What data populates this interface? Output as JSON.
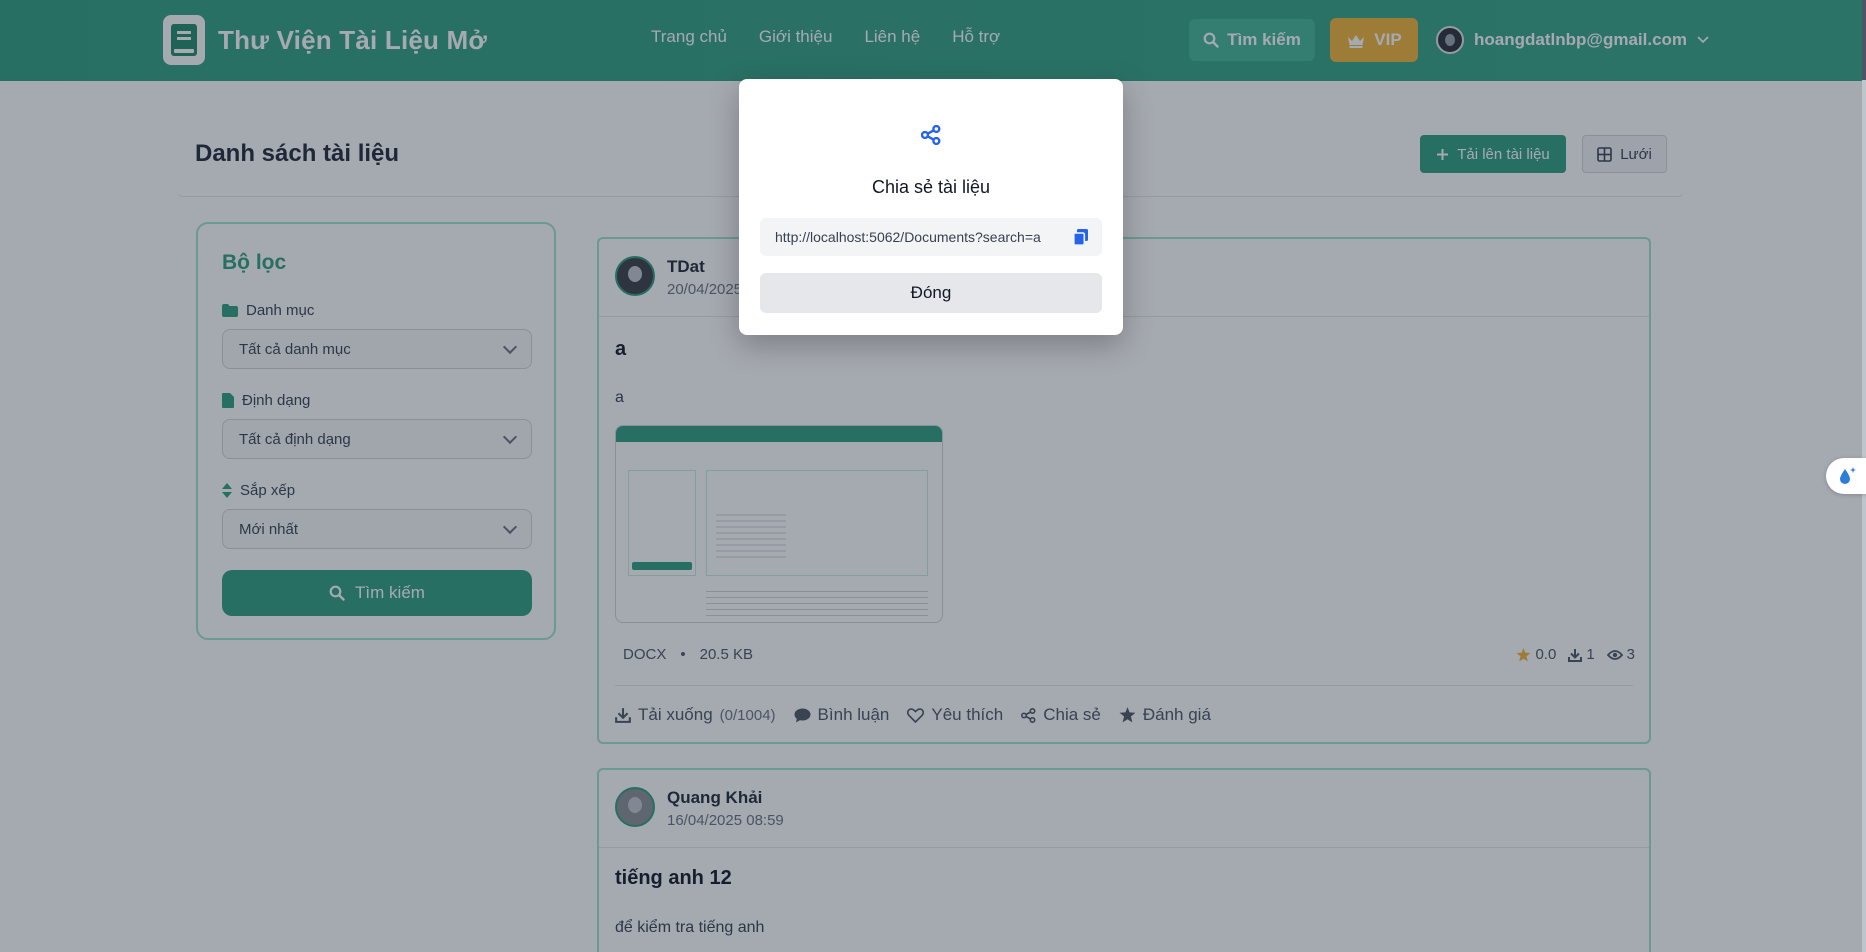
{
  "header": {
    "brand": "Thư Viện Tài Liệu Mở",
    "nav": [
      "Trang chủ",
      "Giới thiệu",
      "Liên hệ",
      "Hỗ trợ"
    ],
    "search_label": "Tìm kiếm",
    "vip_label": "VIP",
    "user_email": "hoangdatlnbp@gmail.com"
  },
  "page": {
    "title": "Danh sách tài liệu",
    "upload_label": "Tải lên tài liệu",
    "view_label": "Lưới"
  },
  "filter": {
    "title": "Bộ lọc",
    "category_label": "Danh mục",
    "category_value": "Tất cả danh mục",
    "format_label": "Định dạng",
    "format_value": "Tất cả định dạng",
    "sort_label": "Sắp xếp",
    "sort_value": "Mới nhất",
    "search_label": "Tìm kiếm"
  },
  "documents": [
    {
      "author": "TDat",
      "time": "20/04/2025",
      "title": "a",
      "description": "a",
      "format": "DOCX",
      "size": "20.5 KB",
      "rating": "0.0",
      "downloads": "1",
      "views": "3",
      "actions": {
        "download": "Tải xuống",
        "download_quota": "(0/1004)",
        "comment": "Bình luận",
        "favorite": "Yêu thích",
        "share": "Chia sẻ",
        "rate": "Đánh giá"
      }
    },
    {
      "author": "Quang Khải",
      "time": "16/04/2025 08:59",
      "title": "tiếng anh 12",
      "description": "để kiểm tra tiếng anh"
    }
  ],
  "modal": {
    "title": "Chia sẻ tài liệu",
    "share_url": "http://localhost:5062/Documents?search=a",
    "close_label": "Đóng"
  },
  "colors": {
    "primary": "#2f9e7f",
    "vip": "#f2b538",
    "link": "#2563eb"
  }
}
